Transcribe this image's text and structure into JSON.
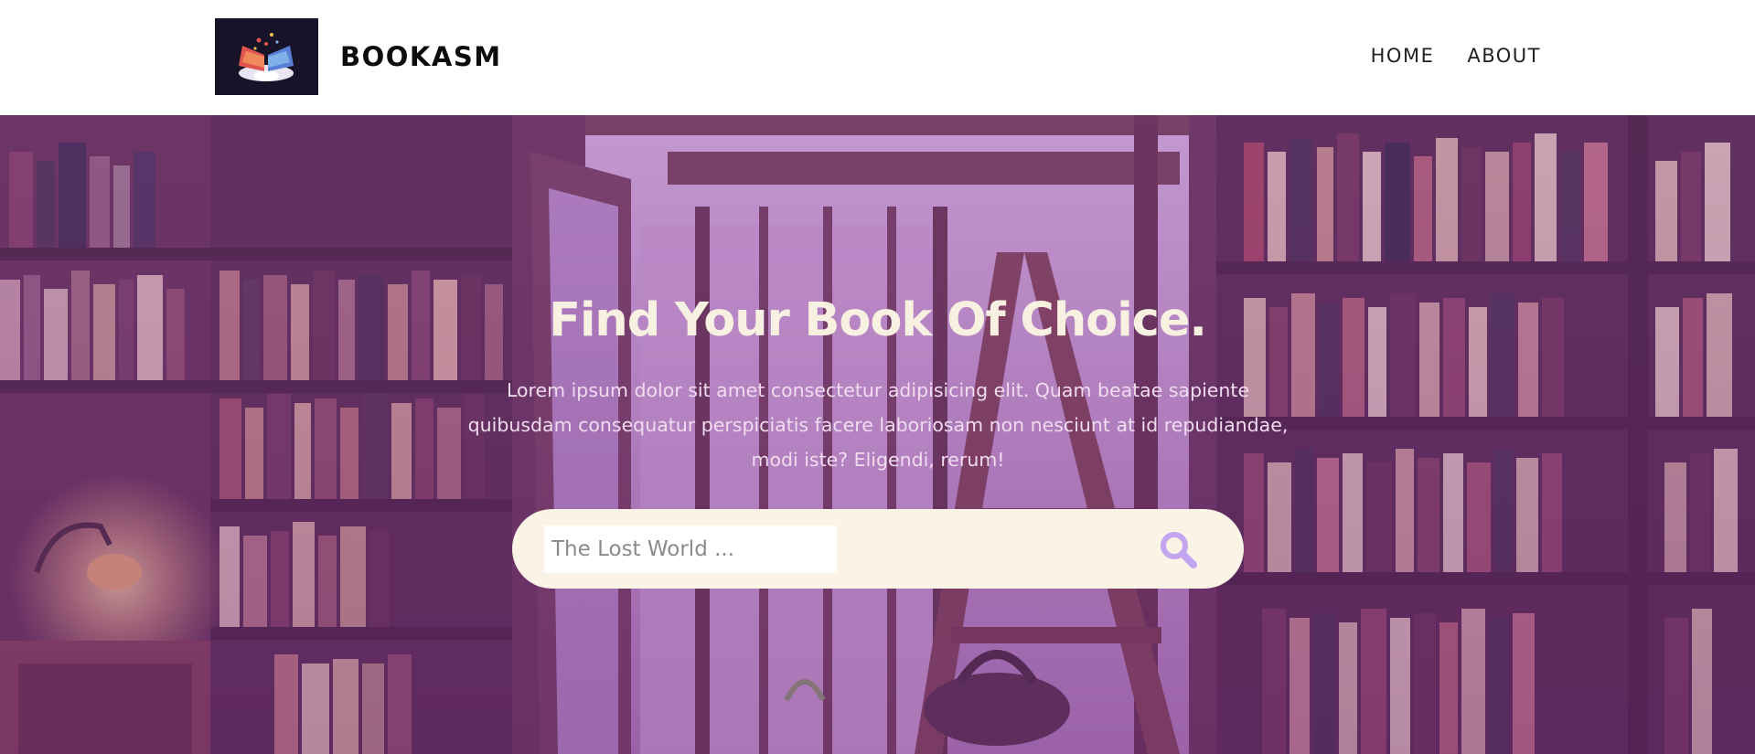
{
  "brand": {
    "name": "BOOKASM"
  },
  "nav": {
    "items": [
      {
        "label": "HOME"
      },
      {
        "label": "ABOUT"
      }
    ]
  },
  "hero": {
    "title": "Find Your Book Of Choice.",
    "description": "Lorem ipsum dolor sit amet consectetur adipisicing elit. Quam beatae sapiente quibusdam consequatur perspiciatis facere laboriosam non nesciunt at id repudiandae, modi iste? Eligendi, rerum!",
    "search": {
      "placeholder": "The Lost World ...",
      "value": ""
    }
  },
  "colors": {
    "hero_title": "#f8f0e0",
    "search_bg": "#faf3e6",
    "search_icon": "#c4a6f0",
    "logo_bg": "#171329"
  },
  "icons": {
    "search": "search-icon",
    "logo": "open-book-icon"
  }
}
